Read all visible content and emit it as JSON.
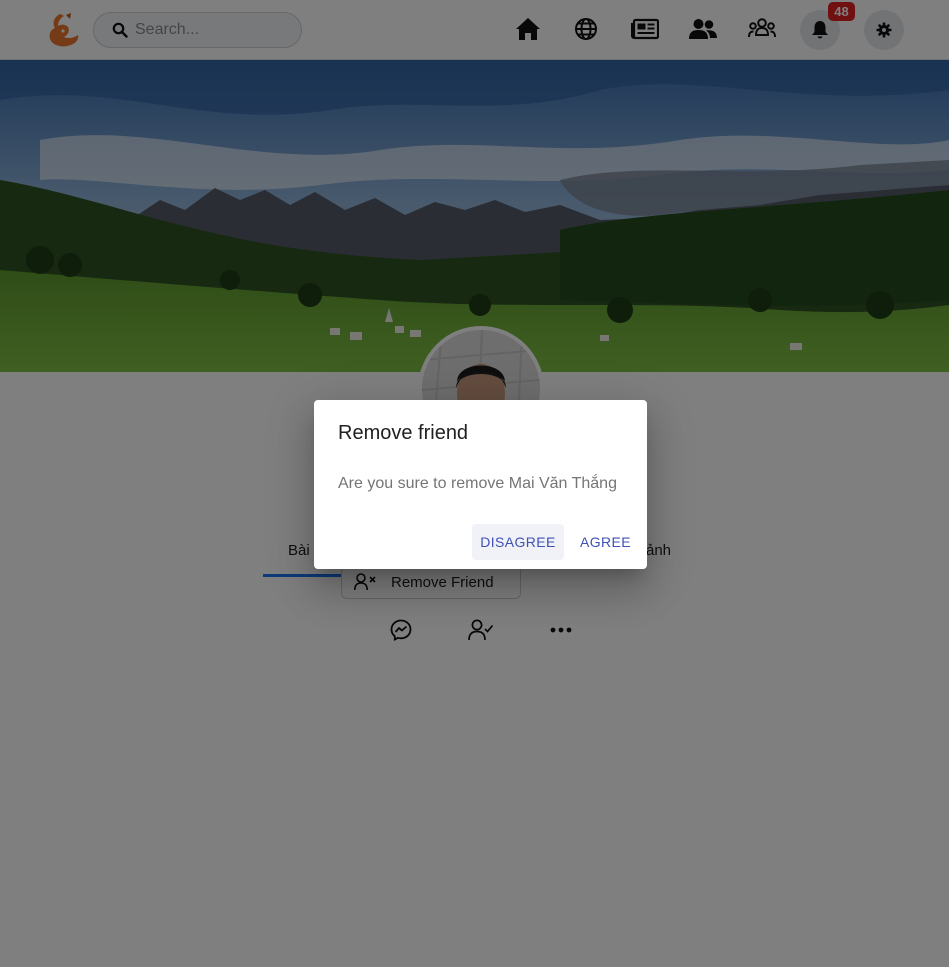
{
  "header": {
    "logo_icon": "fox-logo-icon",
    "search": {
      "placeholder": "Search...",
      "value": ""
    },
    "nav": [
      {
        "name": "home-icon"
      },
      {
        "name": "globe-icon"
      },
      {
        "name": "news-icon"
      },
      {
        "name": "friends-icon"
      },
      {
        "name": "groups-icon"
      }
    ],
    "notifications": {
      "icon": "bell-icon",
      "count": "48"
    },
    "settings": {
      "icon": "gear-icon"
    }
  },
  "cover": {
    "description_icon": "mountain-landscape-image"
  },
  "profile": {
    "tabs": [
      {
        "label": "Bài"
      },
      {
        "label": "ảnh"
      }
    ],
    "remove_friend_label": "Remove Friend",
    "actions": [
      {
        "name": "messenger-icon"
      },
      {
        "name": "user-check-icon"
      },
      {
        "name": "more-icon"
      }
    ]
  },
  "dialog": {
    "title": "Remove friend",
    "message": "Are you sure to remove Mai Văn Thắng",
    "disagree_label": "DISAGREE",
    "agree_label": "AGREE"
  },
  "colors": {
    "accent": "#3f51b5",
    "badge": "#e02020",
    "tab_active": "#1877f2",
    "logo": "#e8762c"
  }
}
